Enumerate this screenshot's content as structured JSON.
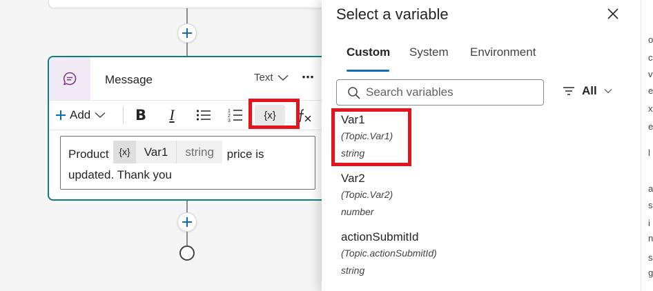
{
  "canvas": {
    "message_card": {
      "title": "Message",
      "type_label": "Text",
      "more_label": "⋯",
      "toolbar": {
        "add_label": "Add",
        "bold_label": "B",
        "italic_label": "I",
        "variable_label": "{x}"
      },
      "editor": {
        "text_before": "Product",
        "token": {
          "icon": "{x}",
          "name": "Var1",
          "type": "string"
        },
        "text_after": "price is updated. Thank you"
      }
    }
  },
  "panel": {
    "title": "Select a variable",
    "tabs": [
      {
        "label": "Custom",
        "active": true
      },
      {
        "label": "System",
        "active": false
      },
      {
        "label": "Environment",
        "active": false
      }
    ],
    "search": {
      "placeholder": "Search variables",
      "value": ""
    },
    "filter_label": "All",
    "variables": [
      {
        "name": "Var1",
        "path": "(Topic.Var1)",
        "type": "string"
      },
      {
        "name": "Var2",
        "path": "(Topic.Var2)",
        "type": "number"
      },
      {
        "name": "actionSubmitId",
        "path": "(Topic.actionSubmitId)",
        "type": "string"
      }
    ]
  },
  "right_strip": {
    "glyphs": [
      "o",
      "c",
      "v",
      "e",
      "x",
      "e",
      "l",
      "a",
      "s",
      "i",
      "n",
      "s",
      "g"
    ]
  },
  "colors": {
    "accent": "#0f6cbd",
    "card_border": "#0e7c86",
    "highlight": "#e3141b",
    "message_icon_bg": "#f1e9f3",
    "message_icon": "#7a3a88"
  },
  "icons": {
    "message_icon": "chat-bubble-icon",
    "add_node": "plus-icon",
    "end_node": "end-circle-icon",
    "close": "close-icon",
    "search": "search-icon",
    "filter": "filter-icon"
  }
}
